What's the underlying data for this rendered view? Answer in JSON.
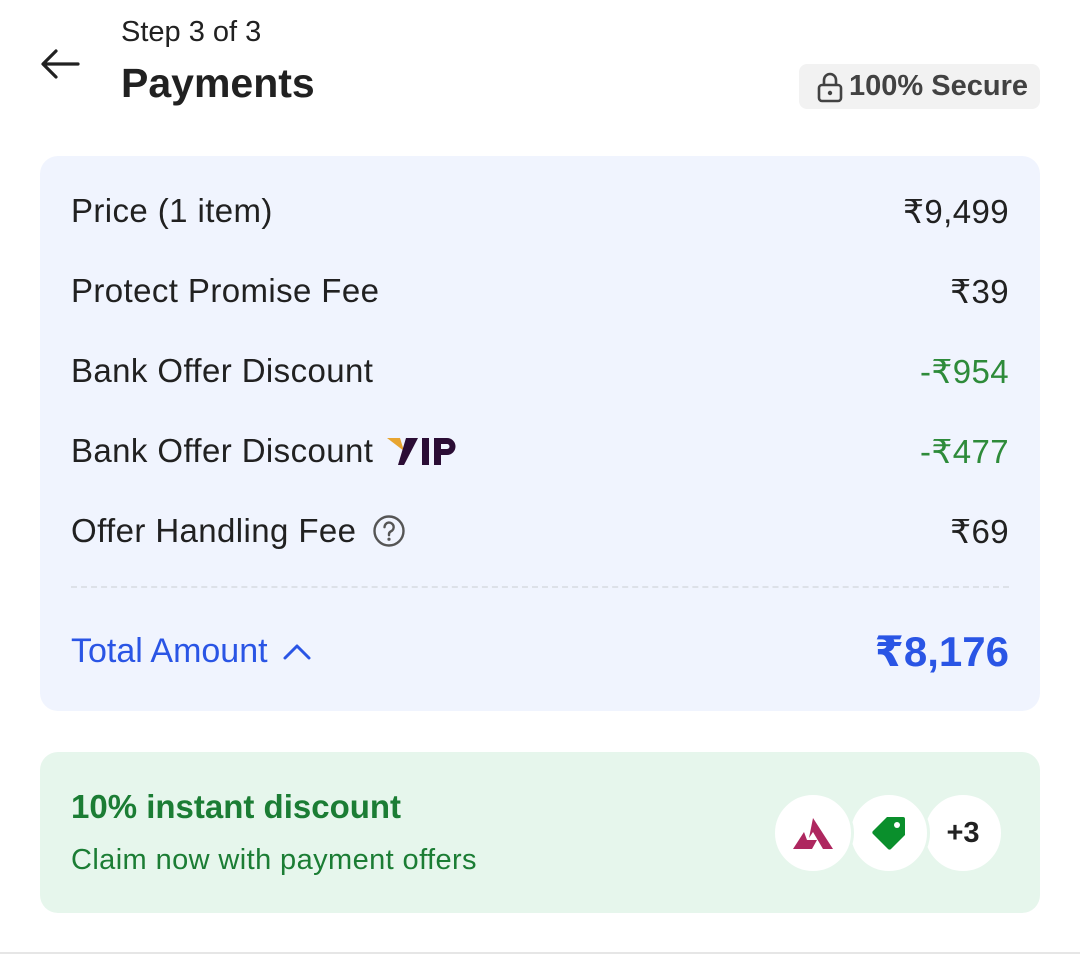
{
  "header": {
    "step": "Step 3 of 3",
    "title": "Payments",
    "secure_label": "100% Secure"
  },
  "price_details": {
    "rows": [
      {
        "label": "Price (1 item)",
        "value": "₹9,499"
      },
      {
        "label": "Protect Promise Fee",
        "value": "₹39"
      },
      {
        "label": "Bank Offer Discount",
        "value": "-₹954"
      },
      {
        "label": "Bank Offer Discount",
        "value": "-₹477",
        "badge": "VIP"
      },
      {
        "label": "Offer Handling Fee",
        "value": "₹69"
      }
    ],
    "total_label": "Total Amount",
    "total_value": "₹8,176"
  },
  "offer": {
    "title": "10% instant discount",
    "subtitle": "Claim now with payment offers",
    "more_count": "+3"
  },
  "colors": {
    "accent_blue": "#2a55e5",
    "discount_green": "#2e8b3a",
    "offer_bg": "#e6f6ec",
    "card_bg": "#f0f4fe"
  }
}
